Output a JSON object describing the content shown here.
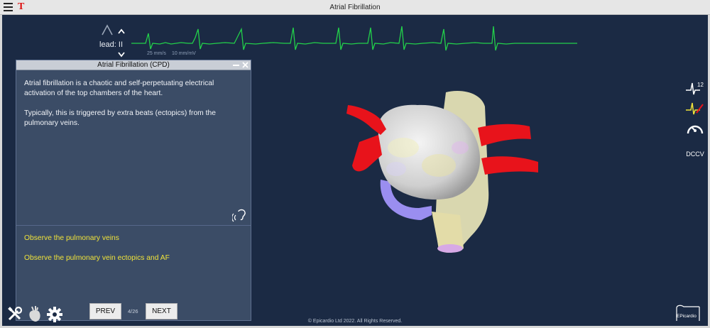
{
  "window": {
    "title": "Atrial Fibrillation"
  },
  "ecg": {
    "lead_label": "lead: II",
    "speed": "25 mm/s",
    "gain": "10 mm/mV",
    "trace_color": "#22d04a"
  },
  "panel": {
    "title": "Atrial Fibrillation (CPD)",
    "paragraphs": [
      "Atrial fibrillation is a chaotic and self-perpetuating electrical activation of the top chambers of the heart.",
      "Typically, this is triggered by extra beats (ectopics) from the pulmonary veins."
    ],
    "tasks": [
      "Observe the pulmonary veins",
      "Observe the pulmonary vein ectopics and AF"
    ],
    "task_color": "#f0e33a"
  },
  "nav": {
    "prev_label": "PREV",
    "next_label": "NEXT",
    "page": "4/26"
  },
  "footer": {
    "copyright": "© Epicardio Ltd 2022. All Rights Reserved."
  },
  "right_toolbar": {
    "icons": [
      "ecg-12-lead-icon",
      "ecg-marker-icon",
      "speed-gauge-icon",
      "dccv-heart-icon"
    ],
    "ecg12_label": "12",
    "dccv_label": "DCCV"
  },
  "logo": {
    "text": "EPicardio"
  },
  "colors": {
    "background": "#1b2a44",
    "panel": "#3b4c66",
    "veins": "#e8131b"
  }
}
